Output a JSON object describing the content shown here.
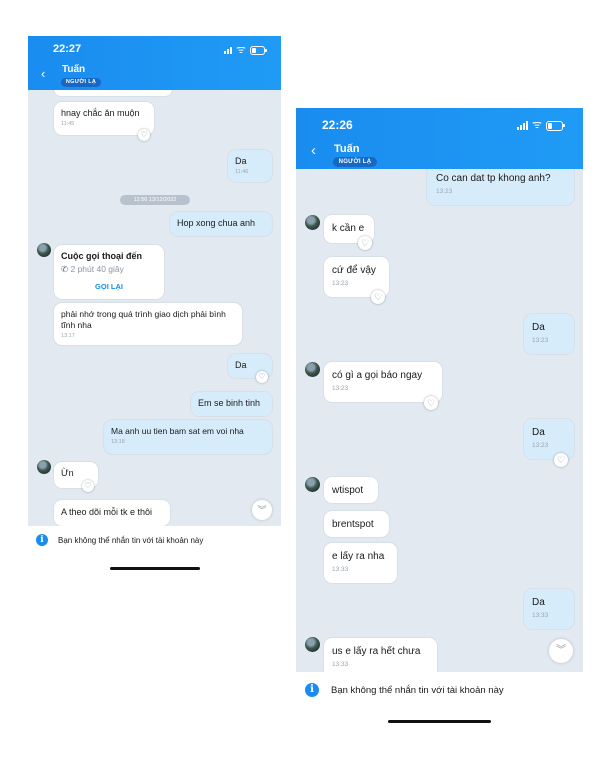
{
  "left": {
    "status": {
      "time": "22:27"
    },
    "header": {
      "back_icon": "chevron-left-icon",
      "name": "Tuấn",
      "tag": "NGƯỜI LẠ"
    },
    "messages": [
      {
        "text": "hnay chắc ăn muộn",
        "time": "11:45"
      },
      {
        "text": "Da",
        "time": "11:46"
      },
      {
        "separator": "12:56 13/12/2022"
      },
      {
        "text": "Hop xong chua anh"
      },
      {
        "call_title": "Cuộc gọi thoại đến",
        "call_duration": "2 phút 40 giây",
        "call_action": "GỌI LẠI"
      },
      {
        "text": "phải nhớ trong quá trình giao dịch phải bình tĩnh nha",
        "time": "13:17"
      },
      {
        "text": "Da"
      },
      {
        "text": "Em se binh tinh"
      },
      {
        "text": "Ma anh uu tien bam sat em voi nha",
        "time": "13:18"
      },
      {
        "text": "Ừn"
      },
      {
        "text": "A theo dõi mỗi tk e thôi"
      }
    ],
    "scroll_icon": "double-chevron-down-icon",
    "notice": "Bạn không thể nhắn tin với tài khoản này"
  },
  "right": {
    "status": {
      "time": "22:26"
    },
    "header": {
      "back_icon": "chevron-left-icon",
      "name": "Tuấn",
      "tag": "NGƯỜI LẠ"
    },
    "messages": [
      {
        "text": "Co can dat tp khong anh?",
        "time": "13:23"
      },
      {
        "text": "k cần e"
      },
      {
        "text": "cứ để vậy",
        "time": "13:23"
      },
      {
        "text": "Da",
        "time": "13:23"
      },
      {
        "text": "có gì a gọi báo ngay",
        "time": "13:23"
      },
      {
        "text": "Da",
        "time": "13:23"
      },
      {
        "text": "wtispot"
      },
      {
        "text": "brentspot"
      },
      {
        "text": "e lấy ra nha",
        "time": "13:33"
      },
      {
        "text": "Da",
        "time": "13:33"
      },
      {
        "text": "us e lấy ra hết chưa",
        "time": "13:33"
      }
    ],
    "scroll_icon": "double-chevron-down-icon",
    "notice": "Bạn không thể nhắn tin với tài khoản này"
  },
  "colors": {
    "header_blue": "#1a8cf0",
    "chat_bg": "#e2e9f0",
    "outgoing_bubble": "#d6ecfb",
    "incoming_bubble": "#ffffff"
  }
}
